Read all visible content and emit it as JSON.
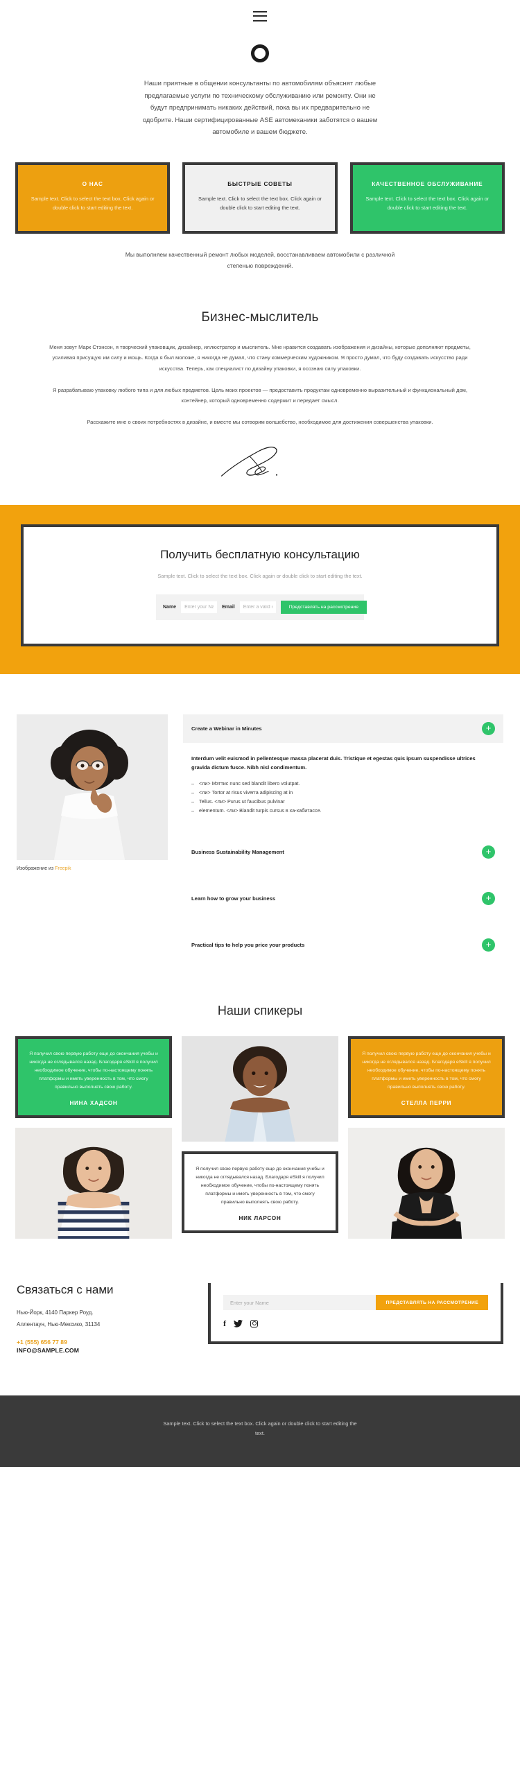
{
  "header": {
    "menu_icon": "hamburger-menu-icon"
  },
  "hero": {
    "logo_icon": "circle-logo-icon",
    "text": "Наши приятные в общении консультанты по автомобилям объяснят любые предлагаемые услуги по техническому обслуживанию или ремонту. Они не будут предпринимать никаких действий, пока вы их предварительно не одобрите. Наши сертифицированные ASE автомеханики заботятся о вашем автомобиле и вашем бюджете."
  },
  "cards": [
    {
      "title": "О НАС",
      "body": "Sample text. Click to select the text box. Click again or double click to start editing the text.",
      "color": "#eda010"
    },
    {
      "title": "БЫСТРЫЕ СОВЕТЫ",
      "body": "Sample text. Click to select the text box. Click again or double click to start editing the text.",
      "color": "#f0f0f0"
    },
    {
      "title": "КАЧЕСТВЕННОЕ ОБСЛУЖИВАНИЕ",
      "body": "Sample text. Click to select the text box. Click again or double click to start editing the text.",
      "color": "#2fc46a"
    }
  ],
  "below_cards_text": "Мы выполняем качественный ремонт любых моделей, восстанавливаем автомобили с различной степенью повреждений.",
  "bio": {
    "title": "Бизнес-мыслитель",
    "paragraph1": "Меня зовут Марк Стэнсон, я творческий упаковщик, дизайнер, иллюстратор и мыслитель. Мне нравится создавать изображения и дизайны, которые дополняют предметы, усиливая присущую им силу и мощь. Когда я был моложе, я никогда не думал, что стану коммерческим художником. Я просто думал, что буду создавать искусство ради искусства. Теперь, как специалист по дизайну упаковки, я осознаю силу упаковки.",
    "paragraph2": "Я разрабатываю упаковку любого типа и для любых предметов. Цель моих проектов — предоставить продуктам одновременно выразительный и функциональный дом, контейнер, который одновременно содержит и передает смысл.",
    "paragraph3": "Расскажите мне о своих потребностях в дизайне, и вместе мы сотворим волшебство, необходимое для достижения совершенства упаковки.",
    "signature_icon": "handwritten-signature-icon"
  },
  "cta": {
    "title": "Получить бесплатную консультацию",
    "subtitle": "Sample text. Click to select the text box. Click again or double click to start editing the text.",
    "name_label": "Name",
    "name_placeholder": "Enter your Name",
    "email_label": "Email",
    "email_placeholder": "Enter a valid email address",
    "submit_label": "Представлять на рассмотрение",
    "band_color": "#f2a20d",
    "submit_color": "#2fc46a"
  },
  "feature": {
    "photo_name": "woman-thinking-photo",
    "credit_prefix": "Изображение из ",
    "credit_link": "Freepik",
    "accordion": [
      {
        "title": "Create a Webinar in Minutes",
        "expanded": true,
        "icon": "plus-icon"
      },
      {
        "title": "Business Sustainability Management",
        "expanded": false,
        "icon": "plus-icon"
      },
      {
        "title": "Learn how to grow your business",
        "expanded": false,
        "icon": "plus-icon"
      },
      {
        "title": "Practical tips to help you price your products",
        "expanded": false,
        "icon": "plus-icon"
      }
    ],
    "body_lead": "Interdum velit euismod in pellentesque massa placerat duis. Tristique et egestas quis ipsum suspendisse ultrices gravida dictum fusce. Nibh nisl condimentum.",
    "body_list": [
      "<ли> Мэттис nunc sed blandit libero volutpat.",
      "<ли> Tortor at risus viverra adipiscing at in",
      "Tellus. <ли> Purus ut faucibus pulvinar",
      "elementum. <ли> Blandit turpis cursus в ха-хабитассе."
    ]
  },
  "speakers": {
    "title": "Наши спикеры",
    "quote": "Я получил свою первую работу еще до окончания учебы и никогда не оглядывался назад. Благодаря eSkill я получил необходимое обучение, чтобы по-настоящему понять платформы и иметь уверенность в том, что смогу правильно выполнять свою работу.",
    "items": [
      {
        "name": "НИНА ХАДСОН",
        "style": "green",
        "photo_name": "speaker-photo-woman-striped"
      },
      {
        "name": "НИК ЛАРСОН",
        "style": "white",
        "photo_name": "speaker-photo-man-shirt"
      },
      {
        "name": "СТЕЛЛА ПЕРРИ",
        "style": "orange",
        "photo_name": "speaker-photo-woman-dark"
      }
    ]
  },
  "contact": {
    "title": "Связаться с нами",
    "address_line1": "Нью-Йорк, 4140 Паркер Роуд.",
    "address_line2": "Аллентаун, Нью-Мексико, 31134",
    "phone": "+1 (555) 656 77 89",
    "email": "INFO@SAMPLE.COM",
    "subscribe_placeholder": "Enter your Name",
    "subscribe_label": "ПРЕДСТАВЛЯТЬ НА РАССМОТРЕНИЕ",
    "social": [
      {
        "icon": "facebook-icon",
        "glyph": "f"
      },
      {
        "icon": "twitter-icon",
        "glyph": "🐦"
      },
      {
        "icon": "instagram-icon",
        "glyph": ""
      }
    ]
  },
  "footer": {
    "text": "Sample text. Click to select the text box. Click again or double click to start editing the text."
  }
}
